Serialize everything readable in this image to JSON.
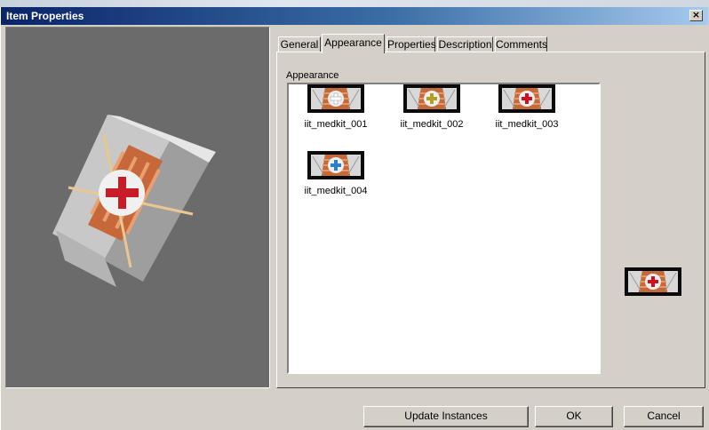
{
  "window": {
    "title": "Item Properties",
    "close_symbol": "×"
  },
  "tabs": [
    {
      "label": "General"
    },
    {
      "label": "Appearance"
    },
    {
      "label": "Properties"
    },
    {
      "label": "Description"
    },
    {
      "label": "Comments"
    }
  ],
  "active_tab": "Appearance",
  "appearance": {
    "group_label": "Appearance",
    "items": [
      {
        "label": "iit_medkit_001",
        "cross_color": "#ffffff"
      },
      {
        "label": "iit_medkit_002",
        "cross_color": "#b0a020"
      },
      {
        "label": "iit_medkit_003",
        "cross_color": "#d01020"
      },
      {
        "label": "iit_medkit_004",
        "cross_color": "#2a7fc8"
      }
    ],
    "selected_preview_cross_color": "#d01020"
  },
  "buttons": {
    "update_instances": "Update Instances",
    "ok": "OK",
    "cancel": "Cancel"
  }
}
